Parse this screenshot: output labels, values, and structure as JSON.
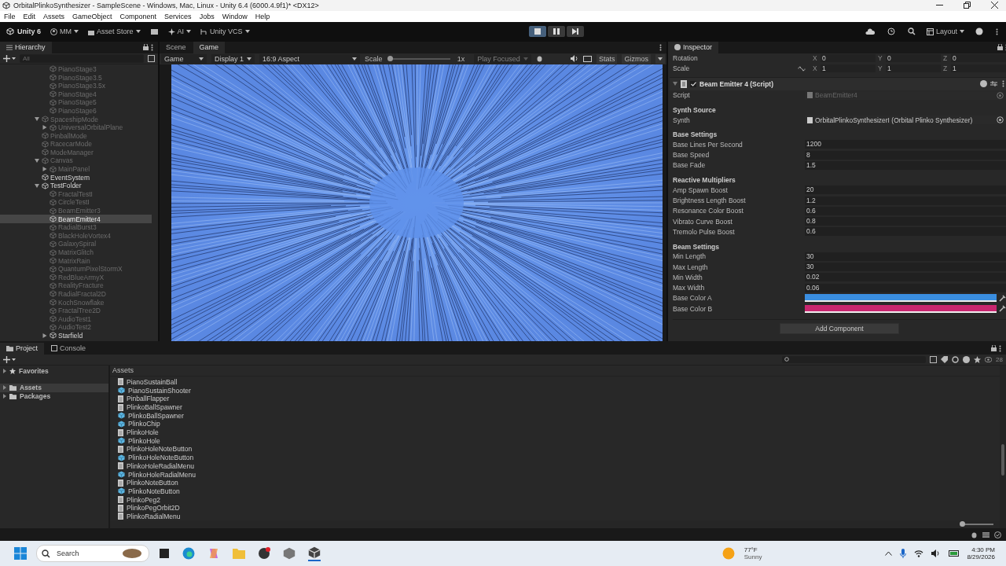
{
  "window": {
    "title": "OrbitalPlinkoSynthesizer - SampleScene - Windows, Mac, Linux - Unity 6.4 (6000.4.9f1)* <DX12>"
  },
  "menu": [
    "File",
    "Edit",
    "Assets",
    "GameObject",
    "Component",
    "Services",
    "Jobs",
    "Window",
    "Help"
  ],
  "toolbar": {
    "account": "Unity 6",
    "user": "MM",
    "asset_store": "Asset Store",
    "ai": "AI",
    "vcs": "Unity VCS",
    "playing": true,
    "layout": "Layout"
  },
  "hierarchy": {
    "tab": "Hierarchy",
    "search_placeholder": "All",
    "continued_items": [
      {
        "name": "PianoStage3",
        "active": false,
        "selected": false
      },
      {
        "name": "PianoStage3.5",
        "active": false,
        "selected": false
      },
      {
        "name": "PianoStage3.5x",
        "active": false,
        "selected": false
      },
      {
        "name": "PianoStage4",
        "active": false,
        "selected": false
      },
      {
        "name": "PianoStage5",
        "active": false,
        "selected": false
      },
      {
        "name": "PianoStage6",
        "active": false,
        "selected": false
      }
    ],
    "items": [
      {
        "name": "SpaceshipMode",
        "active": false,
        "selected": false,
        "expanded": true,
        "children": [
          {
            "name": "UniversalOrbitalPlane",
            "active": false,
            "selected": false,
            "expanded": false
          }
        ]
      },
      {
        "name": "PinballMode",
        "active": false,
        "selected": false
      },
      {
        "name": "RacecarMode",
        "active": false,
        "selected": false
      },
      {
        "name": "ModeManager",
        "active": false,
        "selected": false
      },
      {
        "name": "Canvas",
        "active": false,
        "selected": false,
        "expanded": true,
        "children": [
          {
            "name": "MainPanel",
            "active": false,
            "selected": false,
            "expanded": false
          }
        ]
      },
      {
        "name": "EventSystem",
        "active": true,
        "selected": false
      },
      {
        "name": "TestFolder",
        "active": true,
        "selected": false,
        "expanded": true,
        "children": [
          {
            "name": "FractalTestI",
            "active": false,
            "selected": false
          },
          {
            "name": "CircleTestI",
            "active": false,
            "selected": false
          },
          {
            "name": "BeamEmitter3",
            "active": false,
            "selected": false
          },
          {
            "name": "BeamEmitter4",
            "active": true,
            "selected": true
          },
          {
            "name": "RadialBurst3",
            "active": false,
            "selected": false
          },
          {
            "name": "BlackHoleVortex4",
            "active": false,
            "selected": false
          },
          {
            "name": "GalaxySpiral",
            "active": false,
            "selected": false
          },
          {
            "name": "MatrixGlitch",
            "active": false,
            "selected": false
          },
          {
            "name": "MatrixRain",
            "active": false,
            "selected": false
          },
          {
            "name": "QuantumPixelStormX",
            "active": false,
            "selected": false
          },
          {
            "name": "RedBlueArmyX",
            "active": false,
            "selected": false
          },
          {
            "name": "RealityFracture",
            "active": false,
            "selected": false
          },
          {
            "name": "RadialFractal2D",
            "active": false,
            "selected": false
          },
          {
            "name": "KochSnowflake",
            "active": false,
            "selected": false
          },
          {
            "name": "FractalTree2D",
            "active": false,
            "selected": false
          },
          {
            "name": "AudioTest1",
            "active": false,
            "selected": false
          },
          {
            "name": "AudioTest2",
            "active": false,
            "selected": false
          },
          {
            "name": "Starfield",
            "active": true,
            "selected": false,
            "expanded": false
          }
        ]
      }
    ]
  },
  "game": {
    "tabs": [
      {
        "label": "Scene",
        "selected": false
      },
      {
        "label": "Game",
        "selected": true
      }
    ],
    "view_mode": "Game",
    "display": "Display 1",
    "aspect": "16:9 Aspect",
    "scale_label": "Scale",
    "scale": {
      "level": 0.0
    },
    "scale_value": "1x",
    "play_mode": "Play Focused",
    "stats": "Stats",
    "gizmos": "Gizmos"
  },
  "inspector": {
    "tab": "Inspector",
    "transform_rows": [
      {
        "label": "Rotation",
        "fields": [
          {
            "axis": "X",
            "value": "0"
          },
          {
            "axis": "Y",
            "value": "0"
          },
          {
            "axis": "Z",
            "value": "0"
          }
        ]
      },
      {
        "label": "Scale",
        "fields": [
          {
            "axis": "X",
            "value": "1"
          },
          {
            "axis": "Y",
            "value": "1"
          },
          {
            "axis": "Z",
            "value": "1"
          }
        ]
      }
    ],
    "component": {
      "title": "Beam Emitter 4 (Script)",
      "enabled": true,
      "expanded": true,
      "script_label": "Script",
      "script_value": "BeamEmitter4",
      "sections": [
        {
          "heading": "Synth Source",
          "fields": [
            {
              "kind": "object",
              "label": "Synth",
              "value": "OrbitalPlinkoSynthesizerI (Orbital Plinko Synthesizer)"
            }
          ]
        },
        {
          "heading": "Base Settings",
          "fields": [
            {
              "kind": "number",
              "label": "Base Lines Per Second",
              "value": "1200"
            },
            {
              "kind": "number",
              "label": "Base Speed",
              "value": "8"
            },
            {
              "kind": "number",
              "label": "Base Fade",
              "value": "1.5"
            }
          ]
        },
        {
          "heading": "Reactive Multipliers",
          "fields": [
            {
              "kind": "number",
              "label": "Amp Spawn Boost",
              "value": "20"
            },
            {
              "kind": "number",
              "label": "Brightness Length Boost",
              "value": "1.2"
            },
            {
              "kind": "number",
              "label": "Resonance Color Boost",
              "value": "0.6"
            },
            {
              "kind": "number",
              "label": "Vibrato Curve Boost",
              "value": "0.8"
            },
            {
              "kind": "number",
              "label": "Tremolo Pulse Boost",
              "value": "0.6"
            }
          ]
        },
        {
          "heading": "Beam Settings",
          "fields": [
            {
              "kind": "number",
              "label": "Min Length",
              "value": "30"
            },
            {
              "kind": "number",
              "label": "Max Length",
              "value": "30"
            },
            {
              "kind": "number",
              "label": "Min Width",
              "value": "0.02"
            },
            {
              "kind": "number",
              "label": "Max Width",
              "value": "0.06"
            },
            {
              "kind": "color",
              "label": "Base Color A",
              "color": "#3a8ee0"
            },
            {
              "kind": "color",
              "label": "Base Color B",
              "color": "#c8266f"
            }
          ]
        }
      ]
    },
    "add_component": "Add Component"
  },
  "project": {
    "tabs": [
      {
        "label": "Project",
        "selected": true
      },
      {
        "label": "Console",
        "selected": false
      }
    ],
    "tree": [
      {
        "label": "Favorites",
        "kind": "favorites",
        "selected": false
      },
      {
        "label": "Assets",
        "kind": "folder",
        "selected": true
      },
      {
        "label": "Packages",
        "kind": "folder",
        "selected": false
      }
    ],
    "breadcrumb": "Assets",
    "asset_count": "28",
    "icon_size": {
      "level": 0.0
    },
    "assets": [
      {
        "name": "PianoSustainBall",
        "kind": "script"
      },
      {
        "name": "PianoSustainShooter",
        "kind": "prefab"
      },
      {
        "name": "PinballFlapper",
        "kind": "script"
      },
      {
        "name": "PlinkoBallSpawner",
        "kind": "script"
      },
      {
        "name": "PlinkoBallSpawner",
        "kind": "prefab"
      },
      {
        "name": "PlinkoChip",
        "kind": "prefab"
      },
      {
        "name": "PlinkoHole",
        "kind": "script"
      },
      {
        "name": "PlinkoHole",
        "kind": "prefab"
      },
      {
        "name": "PlinkoHoleNoteButton",
        "kind": "script"
      },
      {
        "name": "PlinkoHoleNoteButton",
        "kind": "prefab"
      },
      {
        "name": "PlinkoHoleRadialMenu",
        "kind": "script"
      },
      {
        "name": "PlinkoHoleRadialMenu",
        "kind": "prefab"
      },
      {
        "name": "PlinkoNoteButton",
        "kind": "script"
      },
      {
        "name": "PlinkoNoteButton",
        "kind": "prefab"
      },
      {
        "name": "PlinkoPeg2",
        "kind": "script"
      },
      {
        "name": "PlinkoPegOrbit2D",
        "kind": "script"
      },
      {
        "name": "PlinkoRadialMenu",
        "kind": "script"
      }
    ]
  },
  "taskbar": {
    "search_placeholder": "Search",
    "temperature": "77°F",
    "weather": "Sunny",
    "time": "4:30 PM",
    "date": "8/29/2026"
  }
}
